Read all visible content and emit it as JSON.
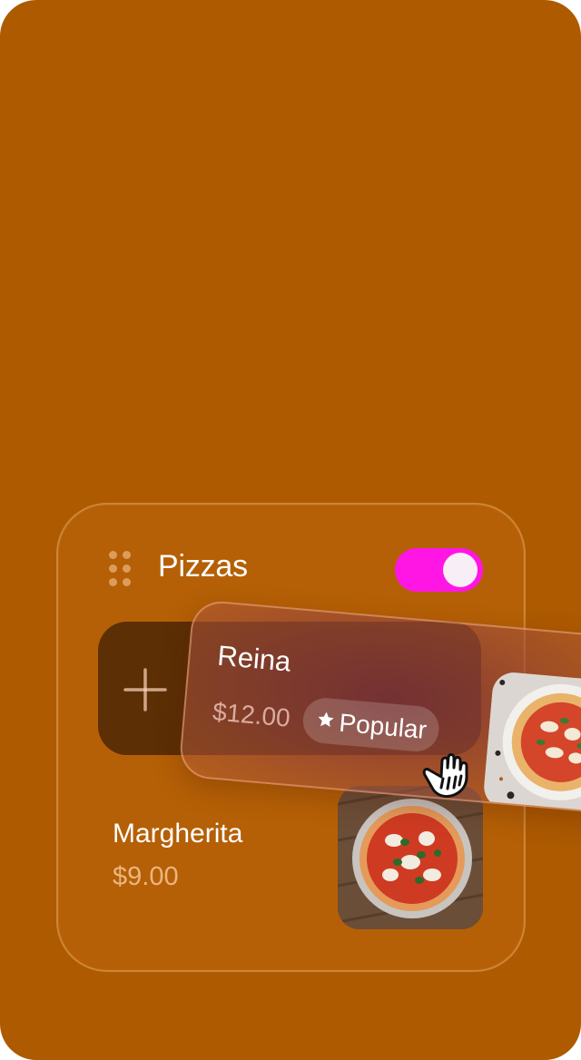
{
  "section": {
    "title": "Pizzas",
    "enabled": true
  },
  "items": [
    {
      "name": "Margherita",
      "price": "$9.00"
    }
  ],
  "dragging_item": {
    "name": "Reina",
    "price": "$12.00",
    "badge": "Popular"
  },
  "colors": {
    "background": "#ad5a00",
    "toggle_on": "#ff16e4",
    "add_tile": "#5c2f05"
  },
  "icons": {
    "drag_handle": "drag-handle-icon",
    "add": "plus-icon",
    "badge": "star-icon",
    "cursor": "grab-hand-icon"
  }
}
